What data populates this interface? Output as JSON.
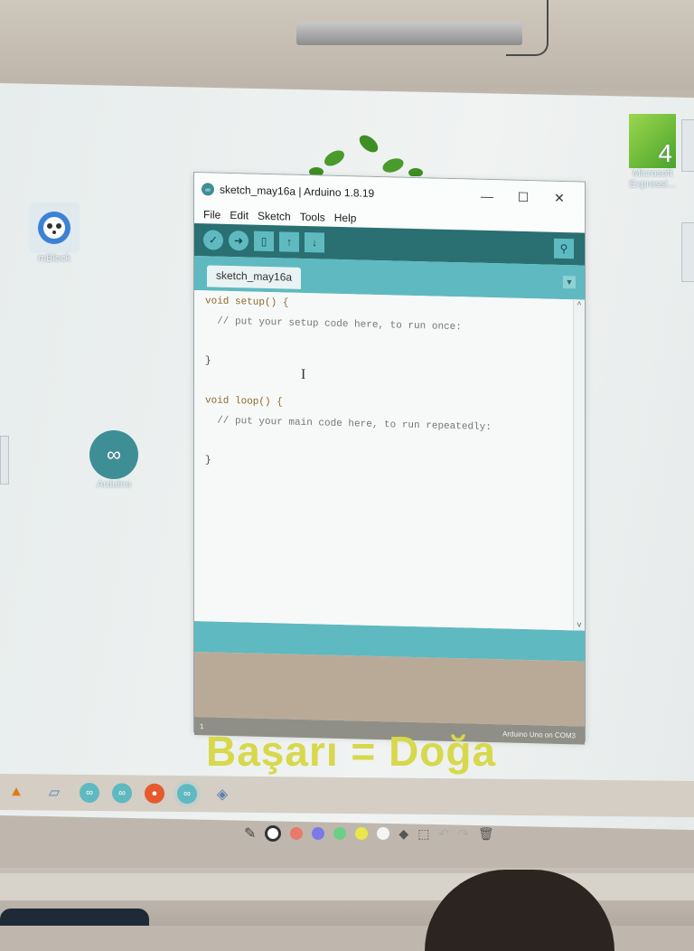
{
  "window": {
    "title": "sketch_may16a | Arduino 1.8.19",
    "controls": {
      "minimize": "—",
      "maximize": "☐",
      "close": "✕"
    },
    "menu": [
      "File",
      "Edit",
      "Sketch",
      "Tools",
      "Help"
    ],
    "tab_label": "sketch_may16a",
    "code_lines": [
      "void setup() {",
      "  // put your setup code here, to run once:",
      "",
      "}",
      "",
      "void loop() {",
      "  // put your main code here, to run repeatedly:",
      "",
      "}"
    ],
    "status_line": "1",
    "status_board": "Arduino Uno on COM3"
  },
  "desktop": {
    "icons": [
      {
        "label": "mBlock",
        "icon": "panda-gear-icon"
      },
      {
        "label": "Arduino",
        "icon": "arduino-infinity-icon"
      },
      {
        "label": "Microsoft Expressi...",
        "icon": "microsoft-expression-icon",
        "badge": "4"
      }
    ],
    "slogan": "Başarı = Doğa"
  },
  "colors": {
    "arduino_teal": "#5fb9c0",
    "arduino_dark": "#2a6f72",
    "slogan_yellow": "#d7d84b"
  },
  "annotation_palette": [
    "#ffffff",
    "#e87a6a",
    "#7a7ae8",
    "#6ccf88",
    "#e8e84a",
    "#f4f4f4"
  ]
}
